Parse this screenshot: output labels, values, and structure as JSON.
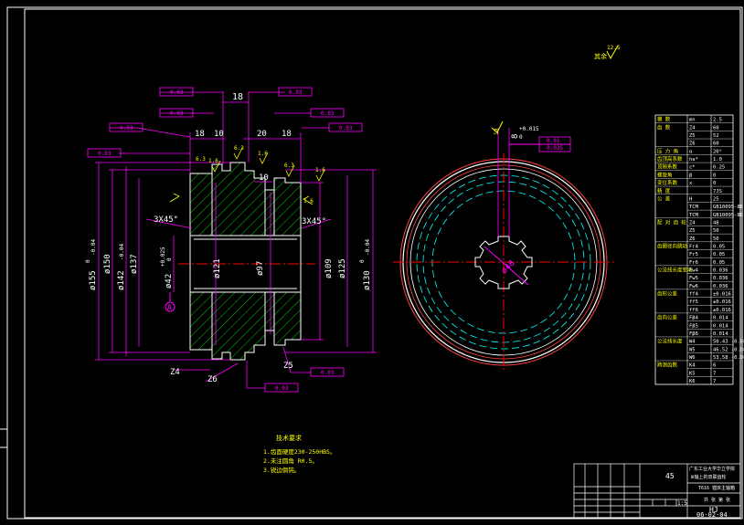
{
  "colors": {
    "background": "#000000",
    "dimension": "#ff00ff",
    "outline": "#ffffff",
    "section": "#00ff00",
    "hatch": "#00ff00",
    "center": "#ff0000",
    "hidden": "#00ffff",
    "highlight": "#ffff00"
  },
  "roughness_general": "其余",
  "roughness_general_value": "12.5",
  "dims_top": {
    "d18a": "18",
    "d18b": "18",
    "d10a": "10",
    "d20": "20",
    "d18c": "18",
    "d10b": "10"
  },
  "roughness": {
    "r1": "1.6",
    "r2": "6.3",
    "r3": "6.3",
    "r4": "1.6",
    "r5": "6.3",
    "r6": "1.6",
    "r7": "1.6"
  },
  "gdt": {
    "g1": "0.03",
    "g2": "0.03",
    "g3": "0.03",
    "g4": "0.03",
    "g5": "0.03",
    "g6": "0.03",
    "g7": "0.03",
    "g8": "0.03",
    "g9": "0.03",
    "datum": "A"
  },
  "chamfer": {
    "left": "3X45°",
    "right": "3X45°"
  },
  "diameters": {
    "d155": "ø155",
    "d155_tol": "0",
    "d155_tol2": "-0.04",
    "d150": "ø150",
    "d142": "ø142",
    "d142_tol": "-0.04",
    "d137": "ø137",
    "d42": "ø42",
    "d42_tol": "+0.025",
    "d42_tol2": "0",
    "d121": "ø121",
    "d97": "ø97",
    "d109": "ø109",
    "d125": "ø125",
    "d130": "ø130",
    "d130_tol": "0",
    "d130_tol2": "-0.04"
  },
  "labels": {
    "datumA": "A",
    "z4": "Z4",
    "z6": "Z6",
    "z5": "Z5",
    "bore": "ø48",
    "keyway": "8",
    "keyway_tol": "+0.015",
    "keyway_tol2": "0",
    "runout1": "0.01",
    "runout2": "0.025",
    "width_l": "19"
  },
  "spec_table": [
    {
      "name": "模 数",
      "sym": "mn",
      "val": "2.5"
    },
    {
      "name": "齿 数",
      "sym": "Z4",
      "val": "60"
    },
    {
      "name": "",
      "sym": "Z5",
      "val": "52"
    },
    {
      "name": "",
      "sym": "Z6",
      "val": "60"
    },
    {
      "name": "压 力 角",
      "sym": "α",
      "val": "20°"
    },
    {
      "name": "齿顶高系数",
      "sym": "ha*",
      "val": "1.0"
    },
    {
      "name": "顶隙系数",
      "sym": "c*",
      "val": "0.25"
    },
    {
      "name": "螺旋角",
      "sym": "β",
      "val": "0"
    },
    {
      "name": "变位系数",
      "sym": "x",
      "val": "0"
    },
    {
      "name": "精 度",
      "sym": "",
      "val": "7JS"
    },
    {
      "name": "公 差",
      "sym": "H",
      "val": "25"
    },
    {
      "name": "",
      "sym": "TCM",
      "val": "GB10095-88"
    },
    {
      "name": "",
      "sym": "TCM",
      "val": "GB10095-88"
    },
    {
      "name": "配 对 齿 轮",
      "sym": "Z4",
      "val": "48"
    },
    {
      "name": "",
      "sym": "Z5",
      "val": "50"
    },
    {
      "name": "",
      "sym": "Z6",
      "val": "50"
    },
    {
      "name": "齿圈径向跳动",
      "sym": "Fr4",
      "val": "0.05"
    },
    {
      "name": "",
      "sym": "Fr5",
      "val": "0.05"
    },
    {
      "name": "",
      "sym": "Fr6",
      "val": "0.05"
    },
    {
      "name": "公法线长度变动",
      "sym": "Fw4",
      "val": "0.036"
    },
    {
      "name": "",
      "sym": "Fw5",
      "val": "0.036"
    },
    {
      "name": "",
      "sym": "Fw6",
      "val": "0.036"
    },
    {
      "name": "齿形公差",
      "sym": "ff4",
      "val": "±0.016"
    },
    {
      "name": "",
      "sym": "ff5",
      "val": "±0.016"
    },
    {
      "name": "",
      "sym": "ff6",
      "val": "±0.016"
    },
    {
      "name": "齿向公差",
      "sym": "Fβ4",
      "val": "0.014"
    },
    {
      "name": "",
      "sym": "Fβ5",
      "val": "0.014"
    },
    {
      "name": "",
      "sym": "Fβ6",
      "val": "0.014"
    },
    {
      "name": "公法线长度",
      "sym": "W4",
      "val": "50.43 -0.08"
    },
    {
      "name": "",
      "sym": "W5",
      "val": "46.52 -0.08"
    },
    {
      "name": "",
      "sym": "W6",
      "val": "53.58 -0.08"
    },
    {
      "name": "跨测齿数",
      "sym": "K4",
      "val": "6"
    },
    {
      "name": "",
      "sym": "K5",
      "val": "7"
    },
    {
      "name": "",
      "sym": "K6",
      "val": "7"
    }
  ],
  "tech_req": {
    "title": "技术要求",
    "l1": "1.齿面硬度230-250HBS。",
    "l2": "2.未注圆角 R0.5。",
    "l3": "3.锐边倒钝。"
  },
  "title_block": {
    "material": "45",
    "school": "广东工业大学华立学院",
    "part_name": "Ⅲ轴上的双联齿轮",
    "subtitle": "T616 镗床主轴箱",
    "scale": "1:5",
    "drawing_no": "HJ",
    "date": "06-02-04",
    "sheet": "共 张 第 张"
  }
}
